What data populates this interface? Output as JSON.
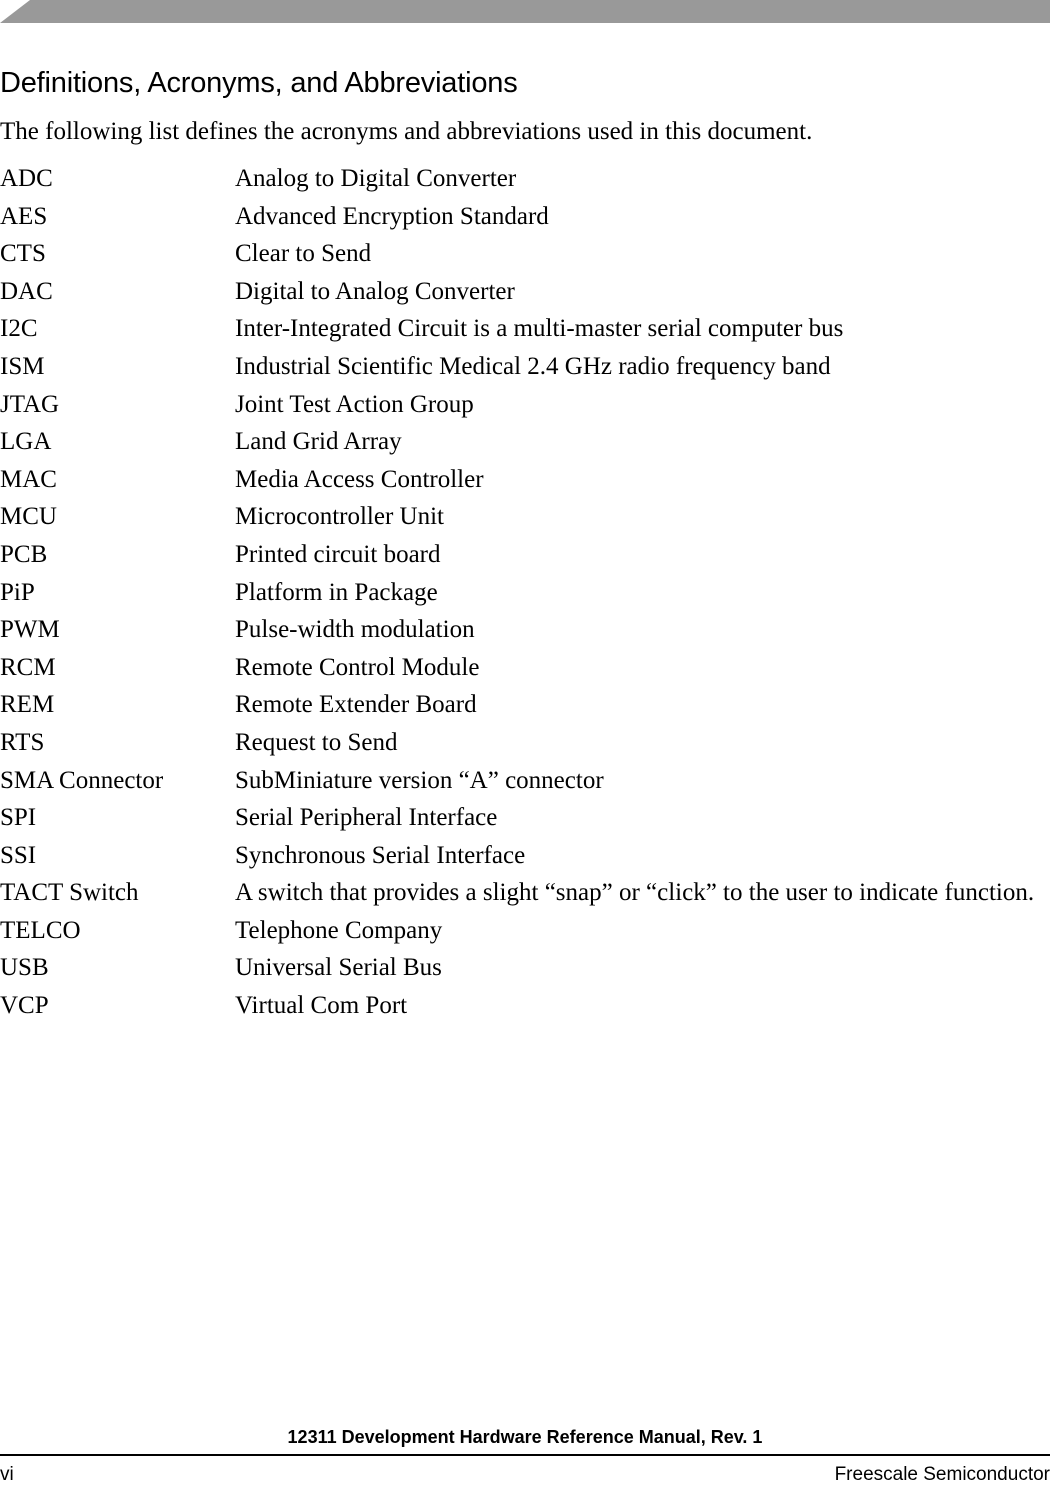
{
  "document": {
    "header_bar_color": "#999999",
    "text_color": "#000000",
    "page_background": "#ffffff"
  },
  "section": {
    "title": "Definitions, Acronyms, and Abbreviations",
    "intro": "The following list defines the acronyms and abbreviations used in this document."
  },
  "definitions": [
    {
      "term": "ADC",
      "description": "Analog to Digital Converter"
    },
    {
      "term": "AES",
      "description": "Advanced Encryption Standard"
    },
    {
      "term": "CTS",
      "description": "Clear to Send"
    },
    {
      "term": "DAC",
      "description": "Digital to Analog Converter"
    },
    {
      "term": "I2C",
      "description": "Inter-Integrated Circuit is a multi-master serial computer bus"
    },
    {
      "term": "ISM",
      "description": "Industrial Scientific Medical 2.4 GHz radio frequency band"
    },
    {
      "term": "JTAG",
      "description": "Joint Test Action Group"
    },
    {
      "term": "LGA",
      "description": "Land Grid Array"
    },
    {
      "term": "MAC",
      "description": "Media Access Controller"
    },
    {
      "term": "MCU",
      "description": "Microcontroller Unit"
    },
    {
      "term": "PCB",
      "description": "Printed circuit board"
    },
    {
      "term": "PiP",
      "description": "Platform in Package"
    },
    {
      "term": "PWM",
      "description": "Pulse-width modulation"
    },
    {
      "term": "RCM",
      "description": "Remote Control Module"
    },
    {
      "term": "REM",
      "description": "Remote Extender Board"
    },
    {
      "term": "RTS",
      "description": "Request to Send"
    },
    {
      "term": "SMA Connector",
      "description": "SubMiniature version “A” connector"
    },
    {
      "term": "SPI",
      "description": "Serial Peripheral Interface"
    },
    {
      "term": "SSI",
      "description": "Synchronous Serial Interface"
    },
    {
      "term": "TACT Switch",
      "description": "A switch that provides a slight “snap” or “click” to the user to indicate function."
    },
    {
      "term": "TELCO",
      "description": "Telephone Company"
    },
    {
      "term": "USB",
      "description": "Universal Serial Bus"
    },
    {
      "term": "VCP",
      "description": "Virtual Com Port"
    }
  ],
  "footer": {
    "manual_title": "12311 Development Hardware Reference Manual, Rev. 1",
    "page_number": "vi",
    "company": "Freescale Semiconductor"
  }
}
